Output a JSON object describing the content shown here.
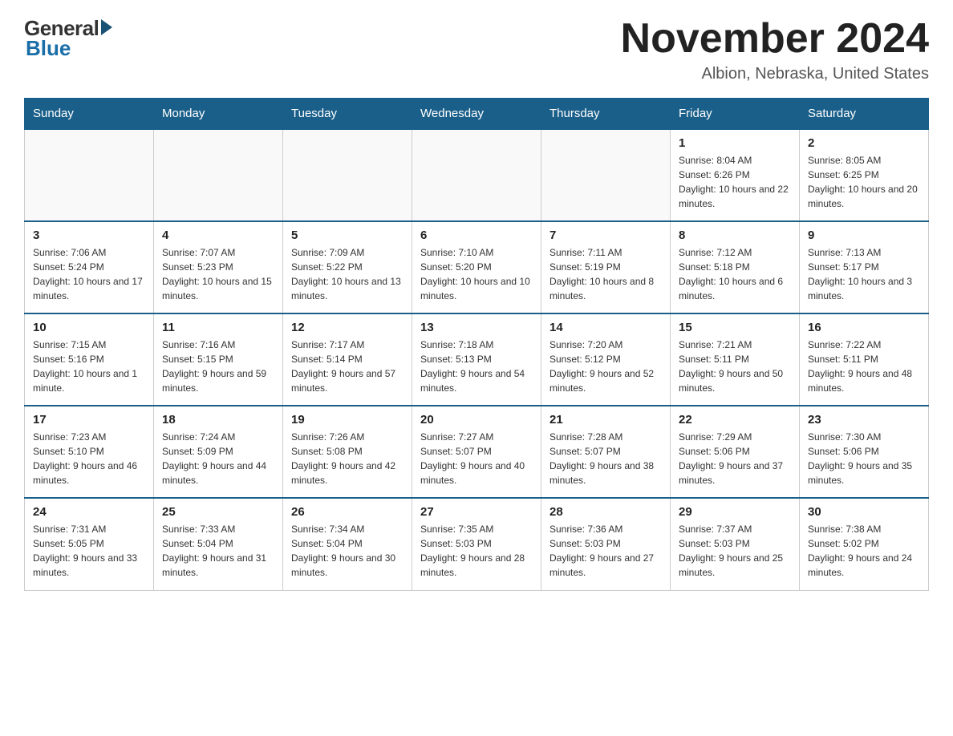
{
  "logo": {
    "general": "General",
    "blue": "Blue"
  },
  "title": {
    "month_year": "November 2024",
    "location": "Albion, Nebraska, United States"
  },
  "days_of_week": [
    "Sunday",
    "Monday",
    "Tuesday",
    "Wednesday",
    "Thursday",
    "Friday",
    "Saturday"
  ],
  "weeks": [
    [
      {
        "day": "",
        "sunrise": "",
        "sunset": "",
        "daylight": "",
        "empty": true
      },
      {
        "day": "",
        "sunrise": "",
        "sunset": "",
        "daylight": "",
        "empty": true
      },
      {
        "day": "",
        "sunrise": "",
        "sunset": "",
        "daylight": "",
        "empty": true
      },
      {
        "day": "",
        "sunrise": "",
        "sunset": "",
        "daylight": "",
        "empty": true
      },
      {
        "day": "",
        "sunrise": "",
        "sunset": "",
        "daylight": "",
        "empty": true
      },
      {
        "day": "1",
        "sunrise": "Sunrise: 8:04 AM",
        "sunset": "Sunset: 6:26 PM",
        "daylight": "Daylight: 10 hours and 22 minutes.",
        "empty": false
      },
      {
        "day": "2",
        "sunrise": "Sunrise: 8:05 AM",
        "sunset": "Sunset: 6:25 PM",
        "daylight": "Daylight: 10 hours and 20 minutes.",
        "empty": false
      }
    ],
    [
      {
        "day": "3",
        "sunrise": "Sunrise: 7:06 AM",
        "sunset": "Sunset: 5:24 PM",
        "daylight": "Daylight: 10 hours and 17 minutes.",
        "empty": false
      },
      {
        "day": "4",
        "sunrise": "Sunrise: 7:07 AM",
        "sunset": "Sunset: 5:23 PM",
        "daylight": "Daylight: 10 hours and 15 minutes.",
        "empty": false
      },
      {
        "day": "5",
        "sunrise": "Sunrise: 7:09 AM",
        "sunset": "Sunset: 5:22 PM",
        "daylight": "Daylight: 10 hours and 13 minutes.",
        "empty": false
      },
      {
        "day": "6",
        "sunrise": "Sunrise: 7:10 AM",
        "sunset": "Sunset: 5:20 PM",
        "daylight": "Daylight: 10 hours and 10 minutes.",
        "empty": false
      },
      {
        "day": "7",
        "sunrise": "Sunrise: 7:11 AM",
        "sunset": "Sunset: 5:19 PM",
        "daylight": "Daylight: 10 hours and 8 minutes.",
        "empty": false
      },
      {
        "day": "8",
        "sunrise": "Sunrise: 7:12 AM",
        "sunset": "Sunset: 5:18 PM",
        "daylight": "Daylight: 10 hours and 6 minutes.",
        "empty": false
      },
      {
        "day": "9",
        "sunrise": "Sunrise: 7:13 AM",
        "sunset": "Sunset: 5:17 PM",
        "daylight": "Daylight: 10 hours and 3 minutes.",
        "empty": false
      }
    ],
    [
      {
        "day": "10",
        "sunrise": "Sunrise: 7:15 AM",
        "sunset": "Sunset: 5:16 PM",
        "daylight": "Daylight: 10 hours and 1 minute.",
        "empty": false
      },
      {
        "day": "11",
        "sunrise": "Sunrise: 7:16 AM",
        "sunset": "Sunset: 5:15 PM",
        "daylight": "Daylight: 9 hours and 59 minutes.",
        "empty": false
      },
      {
        "day": "12",
        "sunrise": "Sunrise: 7:17 AM",
        "sunset": "Sunset: 5:14 PM",
        "daylight": "Daylight: 9 hours and 57 minutes.",
        "empty": false
      },
      {
        "day": "13",
        "sunrise": "Sunrise: 7:18 AM",
        "sunset": "Sunset: 5:13 PM",
        "daylight": "Daylight: 9 hours and 54 minutes.",
        "empty": false
      },
      {
        "day": "14",
        "sunrise": "Sunrise: 7:20 AM",
        "sunset": "Sunset: 5:12 PM",
        "daylight": "Daylight: 9 hours and 52 minutes.",
        "empty": false
      },
      {
        "day": "15",
        "sunrise": "Sunrise: 7:21 AM",
        "sunset": "Sunset: 5:11 PM",
        "daylight": "Daylight: 9 hours and 50 minutes.",
        "empty": false
      },
      {
        "day": "16",
        "sunrise": "Sunrise: 7:22 AM",
        "sunset": "Sunset: 5:11 PM",
        "daylight": "Daylight: 9 hours and 48 minutes.",
        "empty": false
      }
    ],
    [
      {
        "day": "17",
        "sunrise": "Sunrise: 7:23 AM",
        "sunset": "Sunset: 5:10 PM",
        "daylight": "Daylight: 9 hours and 46 minutes.",
        "empty": false
      },
      {
        "day": "18",
        "sunrise": "Sunrise: 7:24 AM",
        "sunset": "Sunset: 5:09 PM",
        "daylight": "Daylight: 9 hours and 44 minutes.",
        "empty": false
      },
      {
        "day": "19",
        "sunrise": "Sunrise: 7:26 AM",
        "sunset": "Sunset: 5:08 PM",
        "daylight": "Daylight: 9 hours and 42 minutes.",
        "empty": false
      },
      {
        "day": "20",
        "sunrise": "Sunrise: 7:27 AM",
        "sunset": "Sunset: 5:07 PM",
        "daylight": "Daylight: 9 hours and 40 minutes.",
        "empty": false
      },
      {
        "day": "21",
        "sunrise": "Sunrise: 7:28 AM",
        "sunset": "Sunset: 5:07 PM",
        "daylight": "Daylight: 9 hours and 38 minutes.",
        "empty": false
      },
      {
        "day": "22",
        "sunrise": "Sunrise: 7:29 AM",
        "sunset": "Sunset: 5:06 PM",
        "daylight": "Daylight: 9 hours and 37 minutes.",
        "empty": false
      },
      {
        "day": "23",
        "sunrise": "Sunrise: 7:30 AM",
        "sunset": "Sunset: 5:06 PM",
        "daylight": "Daylight: 9 hours and 35 minutes.",
        "empty": false
      }
    ],
    [
      {
        "day": "24",
        "sunrise": "Sunrise: 7:31 AM",
        "sunset": "Sunset: 5:05 PM",
        "daylight": "Daylight: 9 hours and 33 minutes.",
        "empty": false
      },
      {
        "day": "25",
        "sunrise": "Sunrise: 7:33 AM",
        "sunset": "Sunset: 5:04 PM",
        "daylight": "Daylight: 9 hours and 31 minutes.",
        "empty": false
      },
      {
        "day": "26",
        "sunrise": "Sunrise: 7:34 AM",
        "sunset": "Sunset: 5:04 PM",
        "daylight": "Daylight: 9 hours and 30 minutes.",
        "empty": false
      },
      {
        "day": "27",
        "sunrise": "Sunrise: 7:35 AM",
        "sunset": "Sunset: 5:03 PM",
        "daylight": "Daylight: 9 hours and 28 minutes.",
        "empty": false
      },
      {
        "day": "28",
        "sunrise": "Sunrise: 7:36 AM",
        "sunset": "Sunset: 5:03 PM",
        "daylight": "Daylight: 9 hours and 27 minutes.",
        "empty": false
      },
      {
        "day": "29",
        "sunrise": "Sunrise: 7:37 AM",
        "sunset": "Sunset: 5:03 PM",
        "daylight": "Daylight: 9 hours and 25 minutes.",
        "empty": false
      },
      {
        "day": "30",
        "sunrise": "Sunrise: 7:38 AM",
        "sunset": "Sunset: 5:02 PM",
        "daylight": "Daylight: 9 hours and 24 minutes.",
        "empty": false
      }
    ]
  ]
}
